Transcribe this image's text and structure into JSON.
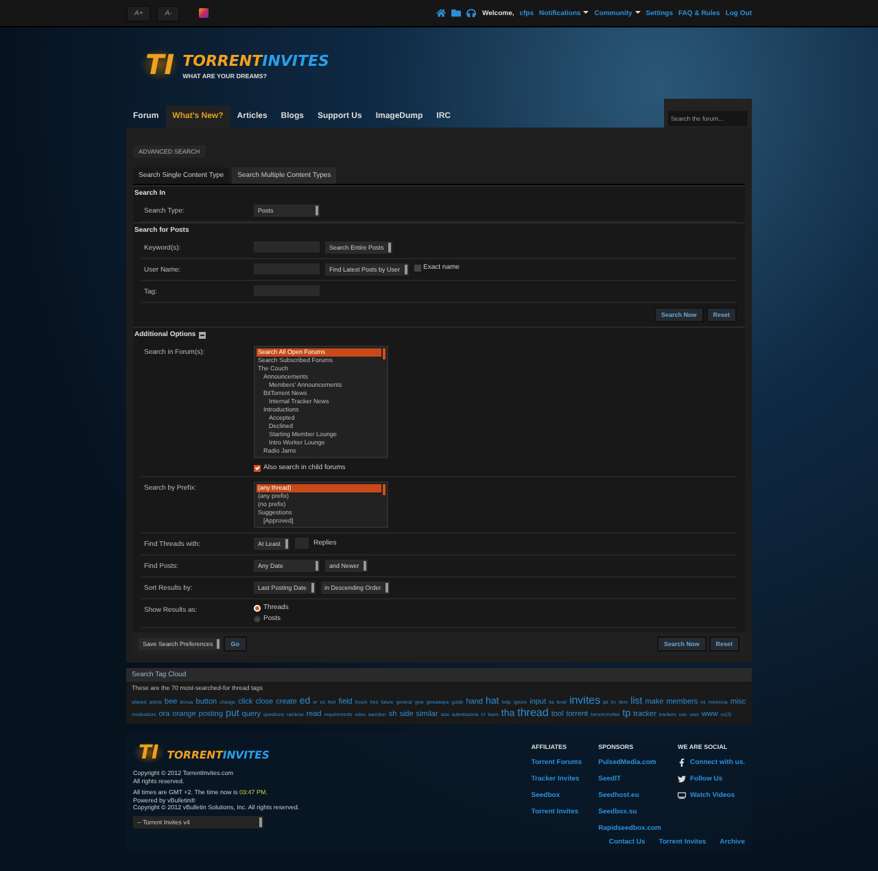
{
  "topbar": {
    "font_buttons": [
      "A+",
      "A-"
    ],
    "welcome": "Welcome,",
    "username": "cfps",
    "links": [
      {
        "label": "Notifications",
        "dropdown": true
      },
      {
        "label": "Community",
        "dropdown": true
      },
      {
        "label": "Settings",
        "dropdown": false
      },
      {
        "label": "FAQ & Rules",
        "dropdown": false
      },
      {
        "label": "Log Out",
        "dropdown": false
      }
    ]
  },
  "logo": {
    "emblem": "TI",
    "name_first": "TORRENT",
    "name_second": "INVITES",
    "tagline": "WHAT ARE YOUR DREAMS?"
  },
  "nav": [
    {
      "label": "Forum",
      "selected": false
    },
    {
      "label": "What's New?",
      "selected": true
    },
    {
      "label": "Articles",
      "selected": false
    },
    {
      "label": "Blogs",
      "selected": false
    },
    {
      "label": "Support Us",
      "selected": false
    },
    {
      "label": "ImageDump",
      "selected": false
    },
    {
      "label": "IRC",
      "selected": false
    }
  ],
  "search": {
    "placeholder": "Search the forum..."
  },
  "panel": {
    "title": "ADVANCED SEARCH",
    "tabs": [
      {
        "label": "Search Single Content Type",
        "selected": true
      },
      {
        "label": "Search Multiple Content Types",
        "selected": false
      }
    ],
    "sections": [
      {
        "heading": "Search In",
        "rows": [
          {
            "label": "Search Type:",
            "controls": [
              {
                "kind": "wide-select",
                "value": "Posts"
              }
            ]
          }
        ]
      },
      {
        "heading": "Search for Posts",
        "rows": [
          {
            "label": "Keyword(s):",
            "controls": [
              {
                "kind": "input"
              },
              {
                "kind": "select",
                "value": "Search Entire Posts"
              }
            ]
          },
          {
            "label": "User Name:",
            "controls": [
              {
                "kind": "input"
              },
              {
                "kind": "select",
                "value": "Find Latest Posts by User"
              },
              {
                "kind": "checkbox",
                "label": "Exact name",
                "checked": false
              }
            ]
          },
          {
            "label": "Tag:",
            "controls": [
              {
                "kind": "input"
              }
            ]
          }
        ],
        "buttons": [
          "Search Now",
          "Reset"
        ]
      },
      {
        "heading": "Additional Options",
        "expanded": true,
        "rows": [
          {
            "label": "Search in Forum(s):",
            "controls": [
              {
                "kind": "listbox",
                "options": [
                  {
                    "label": "Search All Open Forums",
                    "selected": true
                  },
                  {
                    "label": "Search Subscribed Forums",
                    "selected": false
                  },
                  {
                    "label": "The Couch",
                    "selected": false,
                    "children": [
                      {
                        "label": "Announcements",
                        "selected": false,
                        "children": [
                          {
                            "label": "Members' Announcements",
                            "selected": false
                          }
                        ]
                      },
                      {
                        "label": "BitTorrent News",
                        "selected": false,
                        "children": [
                          {
                            "label": "Internal Tracker News",
                            "selected": false
                          }
                        ]
                      },
                      {
                        "label": "Introductions",
                        "selected": false,
                        "children": [
                          {
                            "label": "Accepted",
                            "selected": false
                          },
                          {
                            "label": "Declined",
                            "selected": false
                          },
                          {
                            "label": "Starting Member Lounge",
                            "selected": false
                          },
                          {
                            "label": "Intro Worker Lounge",
                            "selected": false
                          }
                        ]
                      },
                      {
                        "label": "Radio Jams",
                        "selected": false
                      }
                    ]
                  }
                ]
              },
              {
                "kind": "checkbox",
                "label": "Also search in child forums",
                "checked": true
              }
            ]
          },
          {
            "label": "Search by Prefix:",
            "controls": [
              {
                "kind": "listbox",
                "options": [
                  {
                    "label": "(any thread)",
                    "selected": true
                  },
                  {
                    "label": "(any prefix)",
                    "selected": false
                  },
                  {
                    "label": "(no prefix)",
                    "selected": false
                  },
                  {
                    "label": "Suggestions",
                    "selected": false,
                    "children": [
                      {
                        "label": "[Approved]",
                        "selected": false
                      }
                    ]
                  }
                ]
              }
            ]
          },
          {
            "label": "Find Threads with:",
            "controls": [
              {
                "kind": "select",
                "value": "At Least"
              },
              {
                "kind": "short-input"
              },
              {
                "kind": "text",
                "label": "Replies"
              }
            ]
          },
          {
            "label": "Find Posts:",
            "controls": [
              {
                "kind": "wide-select",
                "value": "Any Date"
              },
              {
                "kind": "select",
                "value": "and Newer"
              }
            ]
          },
          {
            "label": "Sort Results by:",
            "controls": [
              {
                "kind": "select",
                "value": "Last Posting Date"
              },
              {
                "kind": "select",
                "value": "in Descending Order"
              }
            ]
          },
          {
            "label": "Show Results as:",
            "controls": [
              {
                "kind": "radio",
                "options": [
                  {
                    "label": "Threads",
                    "selected": true
                  },
                  {
                    "label": "Posts",
                    "selected": false
                  }
                ]
              }
            ]
          }
        ]
      }
    ],
    "footer": {
      "preferences": "Save Search Preferences",
      "go": "Go",
      "buttons": [
        "Search Now",
        "Reset"
      ]
    }
  },
  "tag_cloud": {
    "title": "Search Tag Cloud",
    "description": "These are the 70 most-searched-for thread tags",
    "tags": [
      {
        "label": "altered",
        "kind": "small"
      },
      {
        "label": "article",
        "kind": "small"
      },
      {
        "label": "bee",
        "kind": "medium"
      },
      {
        "label": "bonus",
        "kind": "small"
      },
      {
        "label": "button",
        "kind": "medium"
      },
      {
        "label": "change",
        "kind": "small"
      },
      {
        "label": "click",
        "kind": "medium"
      },
      {
        "label": "close",
        "kind": "medium"
      },
      {
        "label": "create",
        "kind": "medium"
      },
      {
        "label": "ed",
        "kind": "large"
      },
      {
        "label": "er",
        "kind": "small"
      },
      {
        "label": "ez",
        "kind": "small"
      },
      {
        "label": "feel",
        "kind": "small"
      },
      {
        "label": "field",
        "kind": "medium"
      },
      {
        "label": "forum",
        "kind": "small"
      },
      {
        "label": "free",
        "kind": "small"
      },
      {
        "label": "future",
        "kind": "small"
      },
      {
        "label": "general",
        "kind": "small"
      },
      {
        "label": "give",
        "kind": "small"
      },
      {
        "label": "giveaways",
        "kind": "small"
      },
      {
        "label": "guide",
        "kind": "small"
      },
      {
        "label": "hand",
        "kind": "medium"
      },
      {
        "label": "hat",
        "kind": "large"
      },
      {
        "label": "help",
        "kind": "small"
      },
      {
        "label": "ignore",
        "kind": "small"
      },
      {
        "label": "input",
        "kind": "medium"
      },
      {
        "label": "ita",
        "kind": "small"
      },
      {
        "label": "level",
        "kind": "small"
      },
      {
        "label": "invites",
        "kind": "huge"
      },
      {
        "label": "ipt",
        "kind": "small"
      },
      {
        "label": "irc",
        "kind": "small"
      },
      {
        "label": "item",
        "kind": "small"
      },
      {
        "label": "list",
        "kind": "large"
      },
      {
        "label": "make",
        "kind": "medium"
      },
      {
        "label": "members",
        "kind": "medium"
      },
      {
        "label": "mi",
        "kind": "small"
      },
      {
        "label": "mininova",
        "kind": "small"
      },
      {
        "label": "misc",
        "kind": "medium"
      },
      {
        "label": "moderators",
        "kind": "small"
      },
      {
        "label": "ora",
        "kind": "medium"
      },
      {
        "label": "orange",
        "kind": "medium"
      },
      {
        "label": "posting",
        "kind": "medium"
      },
      {
        "label": "put",
        "kind": "large"
      },
      {
        "label": "query",
        "kind": "medium"
      },
      {
        "label": "questions",
        "kind": "small"
      },
      {
        "label": "rainbow",
        "kind": "small"
      },
      {
        "label": "read",
        "kind": "medium"
      },
      {
        "label": "requirements",
        "kind": "small"
      },
      {
        "label": "rules",
        "kind": "small"
      },
      {
        "label": "sanction",
        "kind": "small"
      },
      {
        "label": "sh",
        "kind": "medium"
      },
      {
        "label": "side",
        "kind": "medium"
      },
      {
        "label": "similar",
        "kind": "medium"
      },
      {
        "label": "size",
        "kind": "small"
      },
      {
        "label": "submissions",
        "kind": "small"
      },
      {
        "label": "t-l",
        "kind": "small"
      },
      {
        "label": "team",
        "kind": "small"
      },
      {
        "label": "tha",
        "kind": "large"
      },
      {
        "label": "thread",
        "kind": "huge"
      },
      {
        "label": "tool",
        "kind": "medium"
      },
      {
        "label": "torrent",
        "kind": "medium"
      },
      {
        "label": "torrent-invites",
        "kind": "small"
      },
      {
        "label": "tp",
        "kind": "large"
      },
      {
        "label": "tracker",
        "kind": "medium"
      },
      {
        "label": "trackers",
        "kind": "small"
      },
      {
        "label": "use",
        "kind": "small"
      },
      {
        "label": "user",
        "kind": "small"
      },
      {
        "label": "www",
        "kind": "medium"
      },
      {
        "label": "xx(3)",
        "kind": "small"
      }
    ]
  },
  "site_footer": {
    "logo": {
      "emblem": "TI",
      "name_first": "TORRENT",
      "name_second": "INVITES"
    },
    "copyright": [
      "Copyright © 2012 TorrentInvites.com",
      "All rights reserved."
    ],
    "time_note": "All times are GMT +2. The time now is",
    "time": "03:47 PM.",
    "credits": [
      "Powered by vBulletin®",
      "Copyright © 2012 vBulletin Solutions, Inc. All rights reserved."
    ],
    "style_select": "-- Torrent Invites v4",
    "columns": [
      {
        "title": "AFFILIATES",
        "links": [
          {
            "label": "Torrent Forums"
          },
          {
            "label": "Tracker Invites"
          },
          {
            "label": "Seedbox"
          },
          {
            "label": "Torrent Invites"
          }
        ]
      },
      {
        "title": "SPONSORS",
        "links": [
          {
            "label": "PulsedMedia.com"
          },
          {
            "label": "SeedIT"
          },
          {
            "label": "Seedhost.eu"
          },
          {
            "label": "Seedbox.su"
          },
          {
            "label": "Rapidseedbox.com"
          }
        ]
      },
      {
        "title": "WE ARE SOCIAL",
        "links": [
          {
            "label": "Connect with us."
          },
          {
            "label": "Follow Us"
          },
          {
            "label": "Watch Videos"
          }
        ]
      }
    ],
    "bottom_links": [
      "Contact Us",
      "Torrent Invites",
      "Archive"
    ]
  }
}
